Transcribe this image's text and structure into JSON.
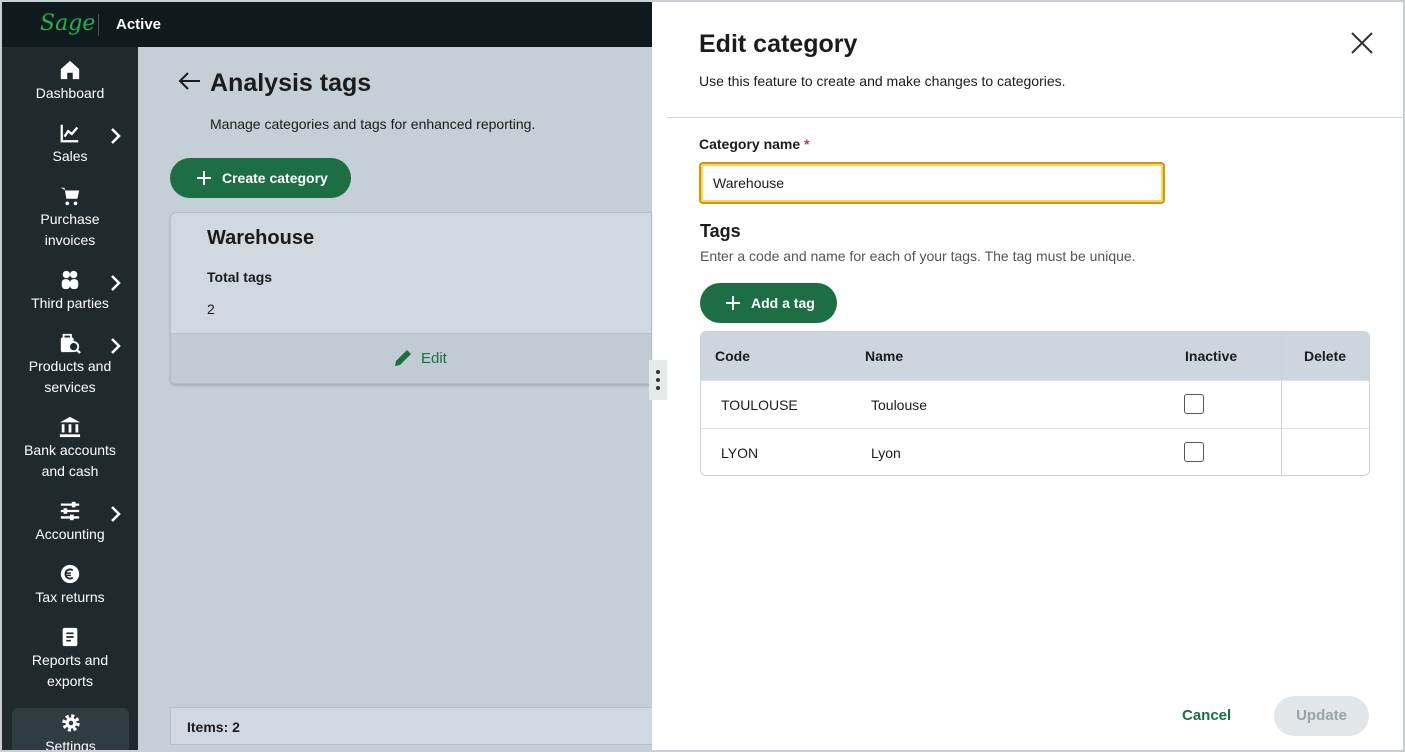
{
  "topbar": {
    "logo": "Sage",
    "company": "Active"
  },
  "sidebar": {
    "items": [
      {
        "line1": "Dashboard",
        "line2": "",
        "icon": "home-icon",
        "chevron": false
      },
      {
        "line1": "Sales",
        "line2": "",
        "icon": "chart-icon",
        "chevron": true
      },
      {
        "line1": "Purchase",
        "line2": "invoices",
        "icon": "cart-icon",
        "chevron": false
      },
      {
        "line1": "Third parties",
        "line2": "",
        "icon": "people-icon",
        "chevron": true
      },
      {
        "line1": "Products and",
        "line2": "services",
        "icon": "products-icon",
        "chevron": true
      },
      {
        "line1": "Bank accounts",
        "line2": "and cash",
        "icon": "bank-icon",
        "chevron": false
      },
      {
        "line1": "Accounting",
        "line2": "",
        "icon": "sliders-icon",
        "chevron": true
      },
      {
        "line1": "Tax returns",
        "line2": "",
        "icon": "euro-icon",
        "chevron": false
      },
      {
        "line1": "Reports and",
        "line2": "exports",
        "icon": "report-icon",
        "chevron": false
      },
      {
        "line1": "Settings",
        "line2": "",
        "icon": "gear-icon",
        "chevron": false
      }
    ]
  },
  "main": {
    "title": "Analysis tags",
    "subtitle": "Manage categories and tags for enhanced reporting.",
    "create_label": "Create category",
    "card": {
      "title": "Warehouse",
      "label": "Total tags",
      "value": "2",
      "edit_label": "Edit"
    },
    "items_label": "Items: 2"
  },
  "drawer": {
    "title": "Edit category",
    "subtitle": "Use this feature to create and make changes to categories.",
    "field_label": "Category name",
    "required_mark": "*",
    "field_value": "Warehouse",
    "tags_heading": "Tags",
    "tags_subtitle": "Enter a code and name for each of your tags. The tag must be unique.",
    "add_tag_label": "Add a tag",
    "columns": {
      "code": "Code",
      "name": "Name",
      "inactive": "Inactive",
      "delete": "Delete"
    },
    "rows": [
      {
        "code": "TOULOUSE",
        "name": "Toulouse",
        "inactive": false
      },
      {
        "code": "LYON",
        "name": "Lyon",
        "inactive": false
      }
    ],
    "cancel_label": "Cancel",
    "update_label": "Update"
  },
  "colors": {
    "brand_green": "#1e6e45",
    "logo_green": "#22b14c",
    "sidebar_bg": "#1e2a2e"
  }
}
